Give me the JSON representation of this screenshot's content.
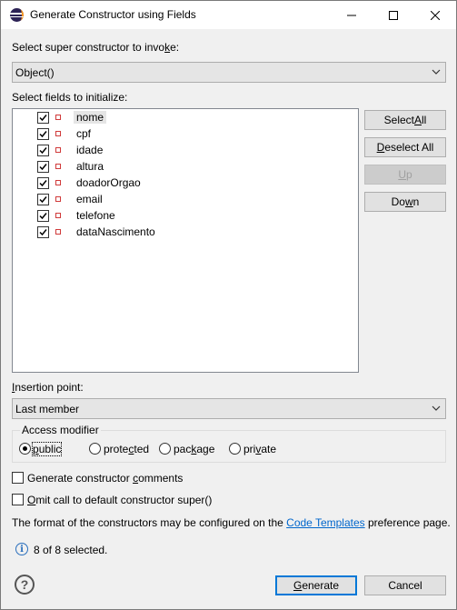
{
  "window": {
    "title": "Generate Constructor using Fields"
  },
  "super_constructor": {
    "label_pre": "Select super constructor to invo",
    "label_mn": "k",
    "label_post": "e:",
    "value": "Object()"
  },
  "fields": {
    "label": "Select fields to initialize:",
    "items": [
      {
        "name": "nome",
        "checked": true
      },
      {
        "name": "cpf",
        "checked": true
      },
      {
        "name": "idade",
        "checked": true
      },
      {
        "name": "altura",
        "checked": true
      },
      {
        "name": "doadorOrgao",
        "checked": true
      },
      {
        "name": "email",
        "checked": true
      },
      {
        "name": "telefone",
        "checked": true
      },
      {
        "name": "dataNascimento",
        "checked": true
      }
    ]
  },
  "buttons": {
    "select_all_pre": "Select ",
    "select_all_mn": "A",
    "select_all_post": "ll",
    "deselect_all_mn": "D",
    "deselect_all_post": "eselect All",
    "up_mn": "U",
    "up_post": "p",
    "down_pre": "Do",
    "down_mn": "w",
    "down_post": "n",
    "generate_mn": "G",
    "generate_post": "enerate",
    "cancel": "Cancel"
  },
  "insertion": {
    "label_mn": "I",
    "label_post": "nsertion point:",
    "value": "Last member"
  },
  "access_modifier": {
    "title": "Access modifier",
    "options": [
      {
        "label_pre": "",
        "label_mn": "p",
        "label_post": "ublic",
        "checked": true
      },
      {
        "label_pre": "prote",
        "label_mn": "c",
        "label_post": "ted",
        "checked": false
      },
      {
        "label_pre": "pac",
        "label_mn": "k",
        "label_post": "age",
        "checked": false
      },
      {
        "label_pre": "pri",
        "label_mn": "v",
        "label_post": "ate",
        "checked": false
      }
    ]
  },
  "options": {
    "comments_pre": "Generate constructor ",
    "comments_mn": "c",
    "comments_post": "omments",
    "omit_mn": "O",
    "omit_post": "mit call to default constructor super()"
  },
  "footer": {
    "text_pre": "The format of the constructors may be configured on the ",
    "link": "Code Templates",
    "text_post": " preference page.",
    "status": "8 of 8 selected."
  }
}
